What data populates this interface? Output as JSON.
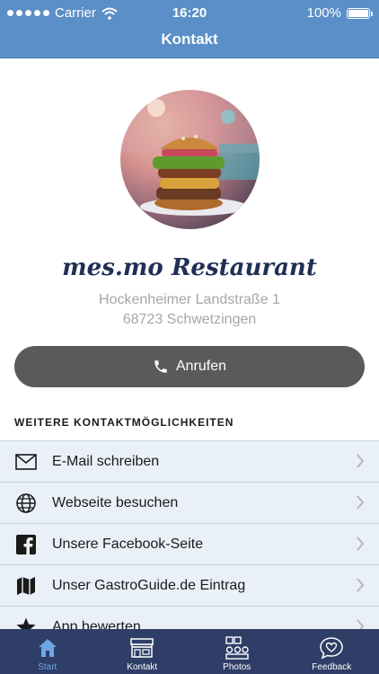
{
  "status_bar": {
    "carrier": "Carrier",
    "time": "16:20",
    "battery": "100%"
  },
  "nav": {
    "title": "Kontakt"
  },
  "restaurant": {
    "name": "mes.mo Restaurant",
    "address_line1": "Hockenheimer Landstraße 1",
    "address_line2": "68723 Schwetzingen"
  },
  "call_button": {
    "label": "Anrufen"
  },
  "section": {
    "title": "WEITERE KONTAKTMÖGLICHKEITEN"
  },
  "contact_options": [
    {
      "label": "E-Mail schreiben",
      "icon": "envelope-icon"
    },
    {
      "label": "Webseite besuchen",
      "icon": "globe-icon"
    },
    {
      "label": "Unsere Facebook-Seite",
      "icon": "facebook-icon"
    },
    {
      "label": "Unser GastroGuide.de Eintrag",
      "icon": "map-icon"
    },
    {
      "label": "App bewerten",
      "icon": "star-icon"
    }
  ],
  "tabs": [
    {
      "label": "Start",
      "icon": "home-icon",
      "active": true
    },
    {
      "label": "Kontakt",
      "icon": "storefront-icon",
      "active": false
    },
    {
      "label": "Photos",
      "icon": "photos-icon",
      "active": false
    },
    {
      "label": "Feedback",
      "icon": "heart-bubble-icon",
      "active": false
    }
  ],
  "colors": {
    "accent": "#5b8fc7",
    "tab_bar": "#2e3e66",
    "tab_active": "#6fa5e3",
    "button": "#5a5a5a"
  }
}
